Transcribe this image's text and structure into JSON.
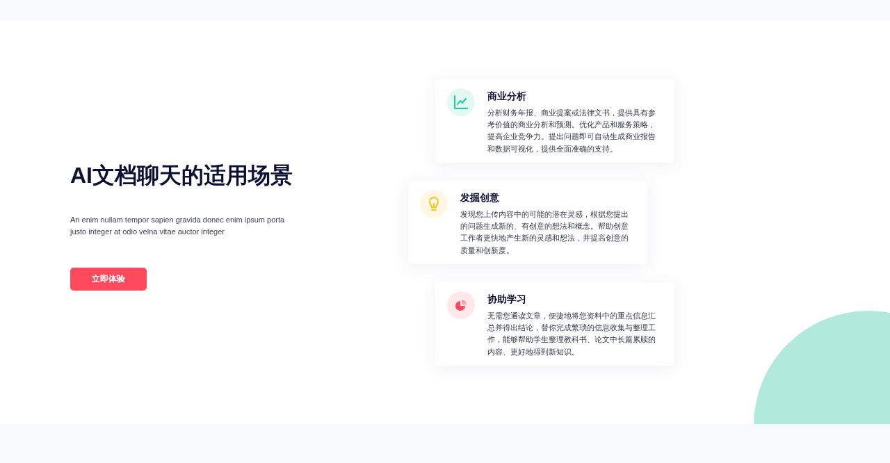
{
  "hero": {
    "title": "AI文档聊天的适用场景",
    "description": "An enim nullam tempor sapien gravida donec enim ipsum porta justo integer at odio velna vitae auctor integer",
    "button": "立即体验"
  },
  "cards": [
    {
      "kind": "chart",
      "color": "#20c997",
      "title": "商业分析",
      "text": "分析财务年报、商业提案或法律文书，提供具有参考价值的商业分析和预测。优化产品和服务策略，提高企业竞争力。提出问题即可自动生成商业报告和数据可视化，提供全面准确的支持。"
    },
    {
      "kind": "bulb",
      "color": "#ffc21a",
      "title": "发掘创意",
      "text": "发现您上传内容中的可能的潜在灵感，根据您提出的问题生成新的、有创意的想法和概念。帮助创意工作者更快地产生新的灵感和想法，并提高创意的质量和创新度。"
    },
    {
      "kind": "pie",
      "color": "#ff4a5e",
      "title": "协助学习",
      "text": "无需您通读文章，便捷地将您资料中的重点信息汇总并得出结论，替你完成繁琐的信息收集与整理工作，能够帮助学生整理教科书、论文中长篇累牍的内容、更好地得到新知识。"
    }
  ]
}
